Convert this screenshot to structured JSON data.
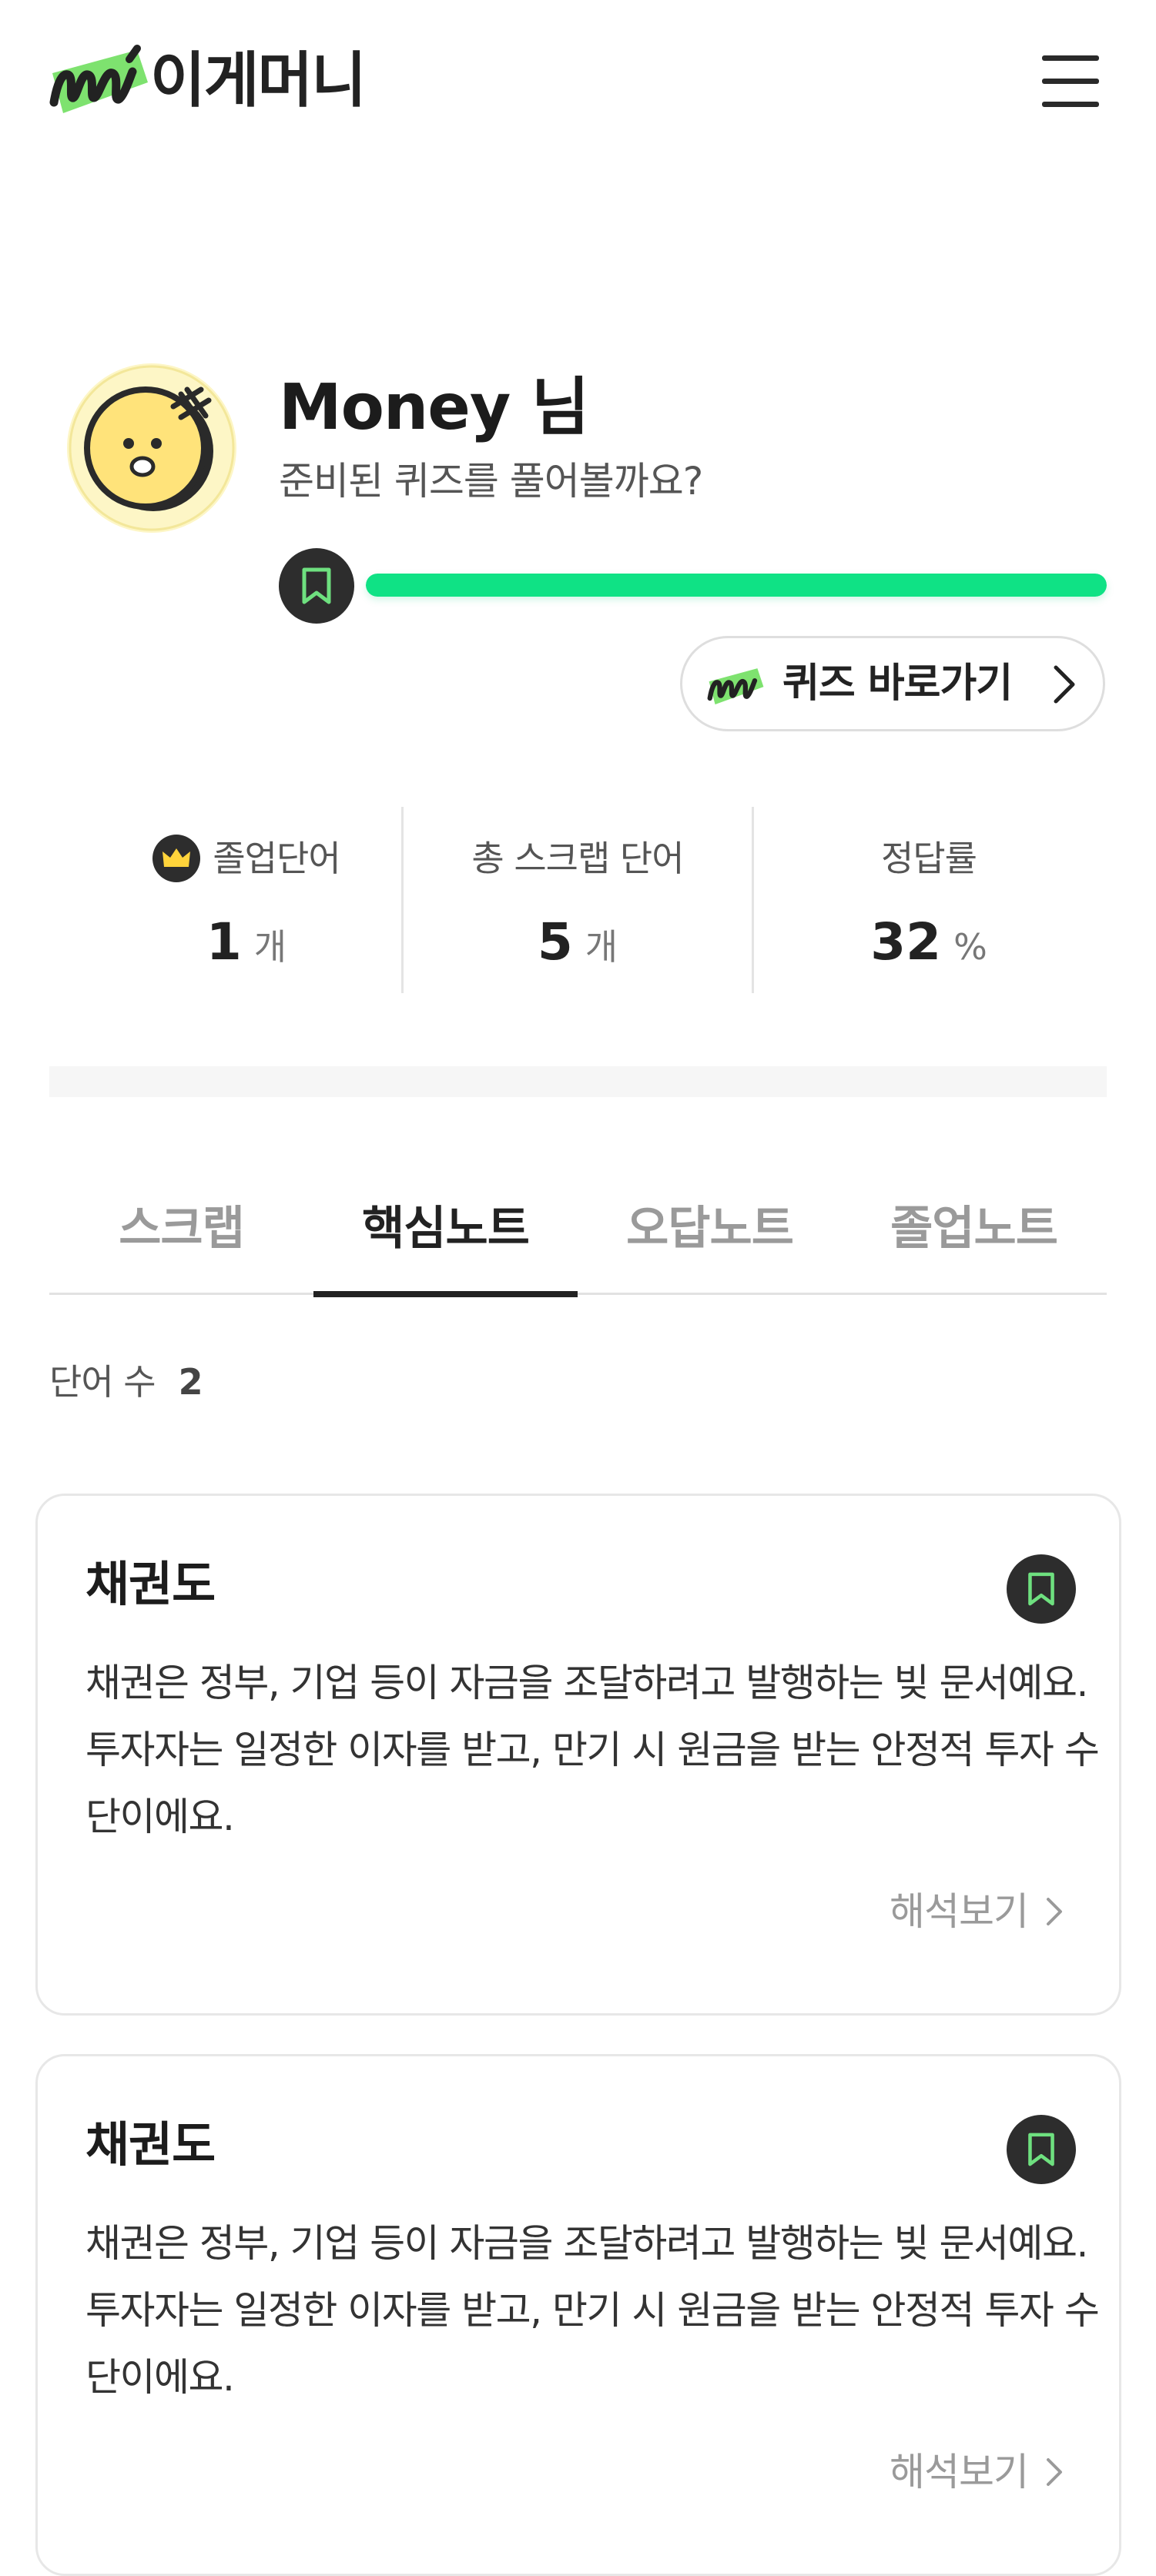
{
  "header": {
    "logo_text": "이게머니",
    "menu_icon": "hamburger-menu-icon"
  },
  "profile": {
    "name": "Money 님",
    "subtitle": "준비된 퀴즈를 풀어볼까요?",
    "progress_fraction": 1.0,
    "quiz_button_label": "퀴즈 바로가기"
  },
  "stats": [
    {
      "label": "졸업단어",
      "value": "1",
      "unit": "개",
      "icon": "crown-icon"
    },
    {
      "label": "총 스크랩 단어",
      "value": "5",
      "unit": "개"
    },
    {
      "label": "정답률",
      "value": "32",
      "unit": "%"
    }
  ],
  "tabs": [
    {
      "label": "스크랩",
      "active": false
    },
    {
      "label": "핵심노트",
      "active": true
    },
    {
      "label": "오답노트",
      "active": false
    },
    {
      "label": "졸업노트",
      "active": false
    }
  ],
  "word_count": {
    "label": "단어 수",
    "value": "2"
  },
  "cards": [
    {
      "title": "채권도",
      "body": "채권은 정부, 기업 등이 자금을 조달하려고 발행하는 빚 문서예요. 투자자는 일정한 이자를 받고, 만기 시 원금을 받는 안정적 투자 수단이에요.",
      "link": "해석보기"
    },
    {
      "title": "채권도",
      "body": "채권은 정부, 기업 등이 자금을 조달하려고 발행하는 빚 문서예요. 투자자는 일정한 이자를 받고, 만기 시 원금을 받는 안정적 투자 수단이에요.",
      "link": "해석보기"
    }
  ],
  "colors": {
    "accent": "#0fe285",
    "dark": "#2d2d2d",
    "bookmark_stroke": "#6ee07f"
  }
}
